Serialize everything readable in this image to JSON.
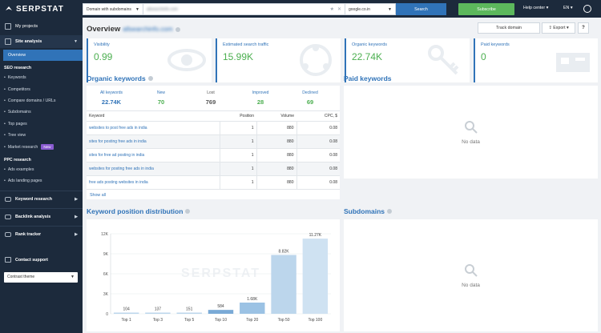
{
  "brand": "SERPSTAT",
  "sidebar": {
    "my_projects": "My projects",
    "site_analysis": "Site analysis",
    "overview": "Overview",
    "seo_research_head": "SEO research",
    "seo_items": [
      "Keywords",
      "Competitors",
      "Compare domains / URLs",
      "Subdomains",
      "Top pages",
      "Tree view",
      "Market research"
    ],
    "new_badge": "New",
    "ppc_head": "PPC research",
    "ppc_items": [
      "Ads examples",
      "Ads landing pages"
    ],
    "groups": [
      "Keyword research",
      "Backlink analysis",
      "Rank tracker"
    ],
    "contact": "Contact support",
    "theme": "Contrast theme"
  },
  "topbar": {
    "domain_mode": "Domain with subdomains",
    "search_value": "allsearchinfo.com",
    "region": "google.co.in",
    "search_label": "Search",
    "subscribe_label": "Subscribe",
    "help_label": "Help center",
    "lang": "EN"
  },
  "page": {
    "title": "Overview",
    "domain": "allsearchinfo.com",
    "track_label": "Track domain",
    "export_label": "Export",
    "help_label": "?"
  },
  "kpis": [
    {
      "label": "Visibility",
      "value": "0.99"
    },
    {
      "label": "Estimated search traffic",
      "value": "15.99K"
    },
    {
      "label": "Organic keywords",
      "value": "22.74K"
    },
    {
      "label": "Paid keywords",
      "value": "0"
    }
  ],
  "organic": {
    "title": "Organic keywords",
    "stats": [
      {
        "label": "All keywords",
        "value": "22.74K"
      },
      {
        "label": "New",
        "value": "70"
      },
      {
        "label": "Lost",
        "value": "769"
      },
      {
        "label": "Improved",
        "value": "28"
      },
      {
        "label": "Declined",
        "value": "69"
      }
    ],
    "columns": [
      "Keyword",
      "Position",
      "Volume",
      "CPC, $"
    ],
    "rows": [
      [
        "websites to post free ads in india",
        "1",
        "880",
        "0.08"
      ],
      [
        "sites for posting free ads in india",
        "1",
        "880",
        "0.08"
      ],
      [
        "sites for free ad posting in india",
        "1",
        "880",
        "0.08"
      ],
      [
        "websites for posting free ads in india",
        "1",
        "880",
        "0.08"
      ],
      [
        "free ads posting websites in india",
        "1",
        "880",
        "0.08"
      ]
    ],
    "show_all": "Show all"
  },
  "paid": {
    "title": "Paid keywords",
    "no_data": "No data"
  },
  "subdomains": {
    "title": "Subdomains",
    "no_data": "No data"
  },
  "distribution": {
    "title": "Keyword position distribution",
    "watermark": "SERPSTAT"
  },
  "chart_data": {
    "type": "bar",
    "categories": [
      "Top 1",
      "Top 3",
      "Top 5",
      "Top 10",
      "Top 20",
      "Top 50",
      "Top 100"
    ],
    "values": [
      104,
      137,
      151,
      584,
      1680,
      8820,
      11270
    ],
    "data_labels": [
      "104",
      "137",
      "151",
      "584",
      "1.68K",
      "8.82K",
      "11.27K"
    ],
    "yticks": [
      "0",
      "3K",
      "6K",
      "9K",
      "12K"
    ],
    "ylim": [
      0,
      12000
    ],
    "colors": [
      "#bcd6ec",
      "#bcd6ec",
      "#bcd6ec",
      "#7aaad6",
      "#9bc2e4",
      "#bcd6ec",
      "#cfe2f2"
    ],
    "grid": true
  }
}
